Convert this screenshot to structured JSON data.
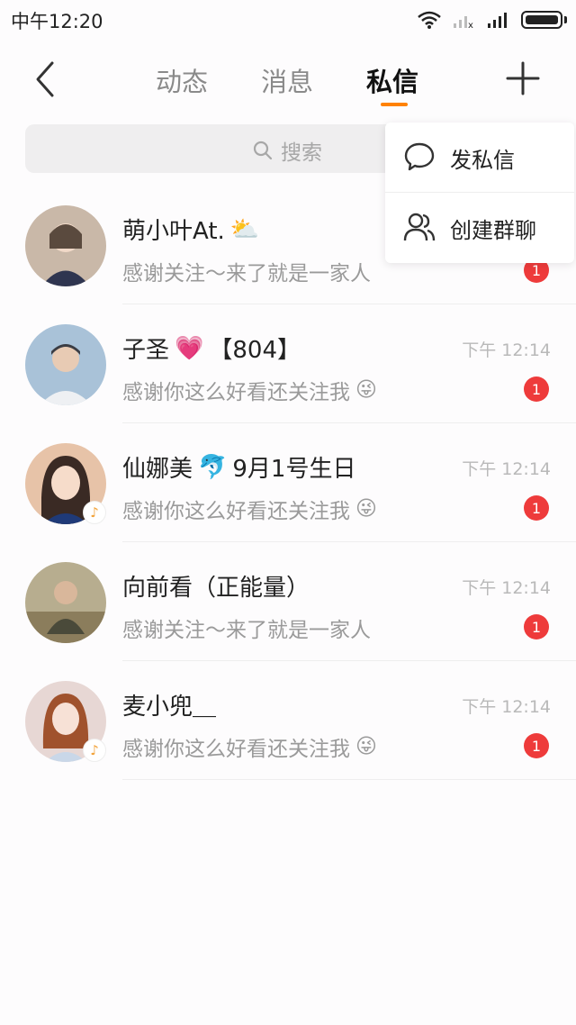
{
  "status_bar": {
    "time": "中午12:20"
  },
  "header": {
    "tabs": [
      {
        "label": "动态"
      },
      {
        "label": "消息"
      },
      {
        "label": "私信"
      }
    ],
    "active_tab": "私信"
  },
  "search": {
    "placeholder": "搜索"
  },
  "popup_menu": {
    "items": [
      {
        "label": "发私信",
        "icon": "chat-bubble-icon"
      },
      {
        "label": "创建群聊",
        "icon": "group-icon"
      }
    ]
  },
  "conversations": [
    {
      "name": "萌小叶At.",
      "emoji": "⛅",
      "message": "感谢关注～来了就是一家人",
      "time": "",
      "unread": "1",
      "avatar_colors": [
        "#c9b8a8",
        "#5a4a3e"
      ]
    },
    {
      "name": "子圣",
      "emoji": "💗",
      "name_suffix": "【804】",
      "message": "感谢你这么好看还关注我",
      "msg_emoji": "😜",
      "time": "下午 12:14",
      "unread": "1",
      "avatar_colors": [
        "#a9c2d8",
        "#3b3d44"
      ]
    },
    {
      "name": "仙娜美",
      "emoji": "🐬",
      "name_suffix": "9月1号生日",
      "message": "感谢你这么好看还关注我",
      "msg_emoji": "😜",
      "time": "下午 12:14",
      "unread": "1",
      "avatar_colors": [
        "#e7c3a8",
        "#3a2a24"
      ]
    },
    {
      "name": "向前看（正能量）",
      "message": "感谢关注～来了就是一家人",
      "time": "下午 12:14",
      "unread": "1",
      "avatar_colors": [
        "#b7ad8f",
        "#4a4a3a"
      ]
    },
    {
      "name": "麦小兜＿",
      "message": "感谢你这么好看还关注我",
      "msg_emoji": "😜",
      "time": "下午 12:14",
      "unread": "1",
      "avatar_colors": [
        "#e7d7d4",
        "#a0522d"
      ]
    }
  ],
  "colors": {
    "accent": "#ff8200",
    "unread": "#ee3b3b"
  }
}
